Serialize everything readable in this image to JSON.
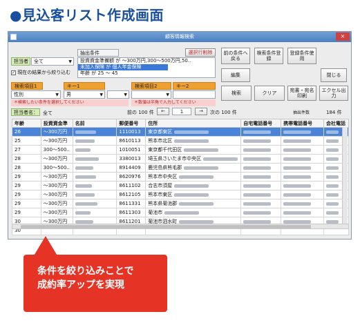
{
  "heading": {
    "title": "●見込客リスト作成画面"
  },
  "window": {
    "title": "顧客情報検索",
    "close_label": "×"
  },
  "conditions": {
    "label": "抽出条件",
    "clear_selected_label": "選択行削除",
    "lines": [
      "投資資金準備額 が ～300万円,300～500万円,50..",
      "未加入保険 が 個人年金保険",
      "年齢 が 25 ～ 45"
    ]
  },
  "owner": {
    "label": "担当者",
    "value": "全て"
  },
  "narrow_check": {
    "label": "現在の結果から絞り込む"
  },
  "buttons": {
    "prev_condition": "前の条件へ戻る",
    "save_condition": "検索条件登録",
    "use_saved": "登録条件使用",
    "edit": "編集",
    "close": "閉じる",
    "search": "検索",
    "clear": "クリア",
    "print": "宛書・宛名印刷",
    "excel": "エクセル出力"
  },
  "search1": {
    "label": "検索項目1",
    "key_label": "キー1",
    "item": "性別",
    "key": "男",
    "hint": "＊検索したい条件を選択してください"
  },
  "search2": {
    "label": "検索項目2",
    "key_label": "キー2",
    "hint": "＊数値は半角で入力してください"
  },
  "pager": {
    "prefix": "前の 100 件",
    "prev": "←",
    "page": "1",
    "next": "→",
    "suffix": "次の 100 件",
    "count_label": "抽出件数",
    "count": "184 件"
  },
  "owner_name": {
    "label": "担当者名：",
    "value": "全て"
  },
  "table": {
    "columns": [
      "年齢",
      "投資資金準",
      "名前",
      "郵便番号",
      "住所",
      "自宅電話番号",
      "携帯電話番号",
      "会社電話"
    ],
    "rows": [
      {
        "age": "26",
        "fund": "～300万円",
        "zip": "1110013",
        "addr": "東京都東区"
      },
      {
        "age": "25",
        "fund": "～300万円",
        "zip": "8610113",
        "addr": "熊本市北区"
      },
      {
        "age": "27",
        "fund": "300～500..",
        "zip": "1010051",
        "addr": "東京都千代田区"
      },
      {
        "age": "28",
        "fund": "～300万円",
        "zip": "3380013",
        "addr": "埼玉県さいたま市中央区"
      },
      {
        "age": "28",
        "fund": "300～500..",
        "zip": "8914409",
        "addr": "鹿児島県熊毛郡"
      },
      {
        "age": "29",
        "fund": "～300万円",
        "zip": "8620976",
        "addr": "熊本市中央区"
      },
      {
        "age": "29",
        "fund": "～300万円",
        "zip": "8611102",
        "addr": "合志市須屋"
      },
      {
        "age": "29",
        "fund": "～300万円",
        "zip": "8612105",
        "addr": "熊本市東区"
      },
      {
        "age": "29",
        "fund": "～300万円",
        "zip": "8611331",
        "addr": "熊本県菊池郡"
      },
      {
        "age": "29",
        "fund": "～300万円",
        "zip": "8611303",
        "addr": "菊池市"
      },
      {
        "age": "30",
        "fund": "～300万円",
        "zip": "8611201",
        "addr": "菊池市泗水町"
      },
      {
        "age": "30",
        "fund": "",
        "zip": "",
        "addr": ""
      }
    ]
  },
  "callout": {
    "line1": "条件を絞り込みことで",
    "line2": "成約率アップを実現"
  },
  "colors": {
    "accent": "#1a4fa0",
    "callout": "#e53325",
    "selected_row": "#4a84d8",
    "orange": "#f0a030"
  }
}
